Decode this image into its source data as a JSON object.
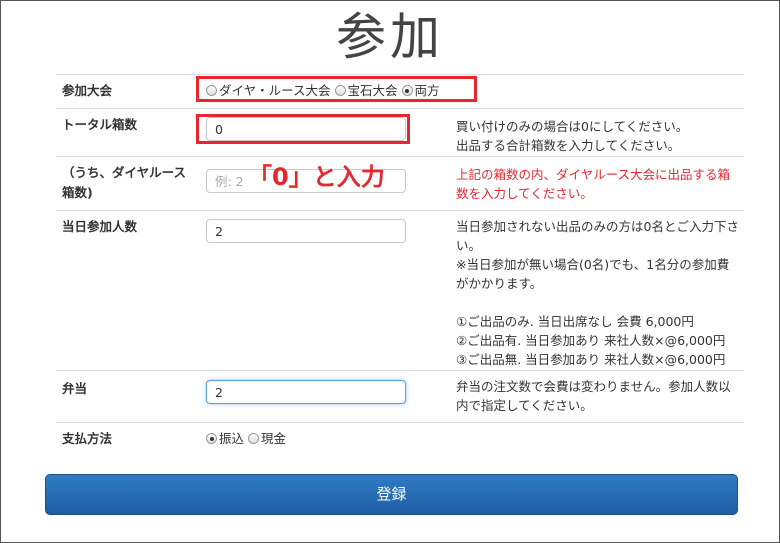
{
  "page": {
    "title": "参加"
  },
  "participation": {
    "label": "参加大会",
    "options": [
      {
        "label": "ダイヤ・ルース大会",
        "checked": false
      },
      {
        "label": "宝石大会",
        "checked": false
      },
      {
        "label": "両方",
        "checked": true
      }
    ]
  },
  "total_boxes": {
    "label": "トータル箱数",
    "value": "0",
    "help": [
      "買い付けのみの場合は0にしてください。",
      "出品する合計箱数を入力してください。"
    ]
  },
  "annotation": {
    "text": "「0」と入力",
    "color": "#e8262e"
  },
  "diamond_boxes": {
    "label_lines": [
      "（うち、ダイヤルース",
      "箱数)"
    ],
    "placeholder": "例: 2",
    "help": [
      "上記の箱数の内、ダイヤルース大会に出品する箱",
      "数を入力してください。"
    ]
  },
  "attendees": {
    "label": "当日参加人数",
    "value": "2",
    "help": [
      "当日参加されない出品のみの方は0名とご入力下さ",
      "い。",
      "※当日参加が無い場合(0名)でも、1名分の参加費",
      "がかかります。",
      "",
      "①ご出品のみ. 当日出席なし 会費 6,000円",
      "②ご出品有. 当日参加あり 来社人数×@6,000円",
      "③ご出品無. 当日参加あり 来社人数×@6,000円"
    ]
  },
  "bento": {
    "label": "弁当",
    "value": "2",
    "help": [
      "弁当の注文数で会費は変わりません。参加人数以",
      "内で指定してください。"
    ]
  },
  "payment": {
    "label": "支払方法",
    "options": [
      {
        "label": "振込",
        "checked": true
      },
      {
        "label": "現金",
        "checked": false
      }
    ]
  },
  "submit": {
    "label": "登録"
  },
  "colors": {
    "accent": "#1e5da3",
    "highlight": "#e8262e"
  }
}
